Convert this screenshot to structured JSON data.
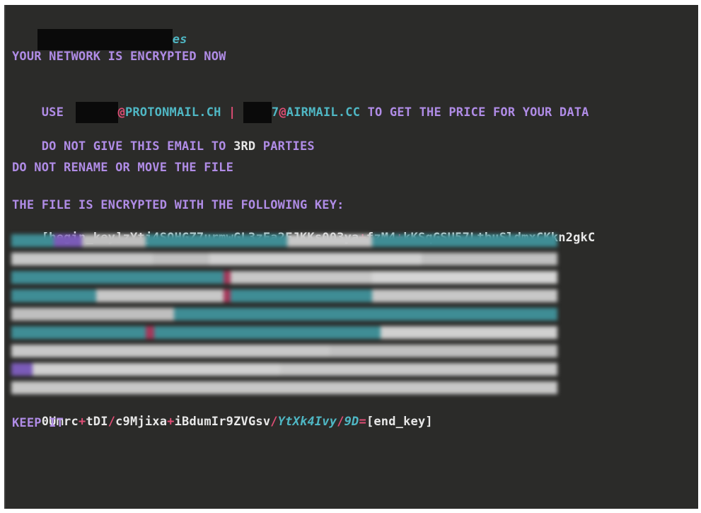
{
  "title_suffix": "es",
  "lines": {
    "network": "YOUR NETWORK IS ENCRYPTED NOW",
    "use_prefix": "USE ",
    "email1_domain": "@PROTONMAIL.CH",
    "separator": " | ",
    "email2_tail": "7",
    "email2_domain": "@AIRMAIL.CC",
    "use_suffix": " TO GET THE PRICE FOR YOUR DATA",
    "no_third_a": "DO NOT GIVE THIS EMAIL TO ",
    "no_third_b": "3RD",
    "no_third_c": " PARTIES",
    "no_rename": "DO NOT RENAME OR MOVE THE FILE",
    "key_heading": "THE FILE IS ENCRYPTED WITH THE FOLLOWING KEY:",
    "key_begin_a": "[begin_key]zYtj4SQHGZ7urmwGL3zFa2FJKKs003ya",
    "key_begin_plus1": "+",
    "key_begin_b": "fzM4",
    "key_begin_plus2": "+",
    "key_begin_c": "kKSqGSU57LtbuSldmxCKkn2gkC",
    "key_end_a": "0Umrc",
    "key_end_plus1": "+",
    "key_end_b": "tDI",
    "key_end_slash1": "/",
    "key_end_c": "c9Mjixa",
    "key_end_plus2": "+",
    "key_end_d": "iBdumIr9ZVGsv",
    "key_end_slash2": "/",
    "key_end_e": "YtXk4Ivy",
    "key_end_slash3": "/",
    "key_end_f": "9D",
    "key_end_eq": "=",
    "key_end_g": "[end_key]",
    "keep_it": "KEEP IT"
  },
  "colors": {
    "background": "#2b2b29",
    "heading": "#b08ce6",
    "key_text": "#e8e8e8",
    "symbol": "#e04d75",
    "domain": "#4fb7c4",
    "redaction": "#0a0a0a"
  }
}
